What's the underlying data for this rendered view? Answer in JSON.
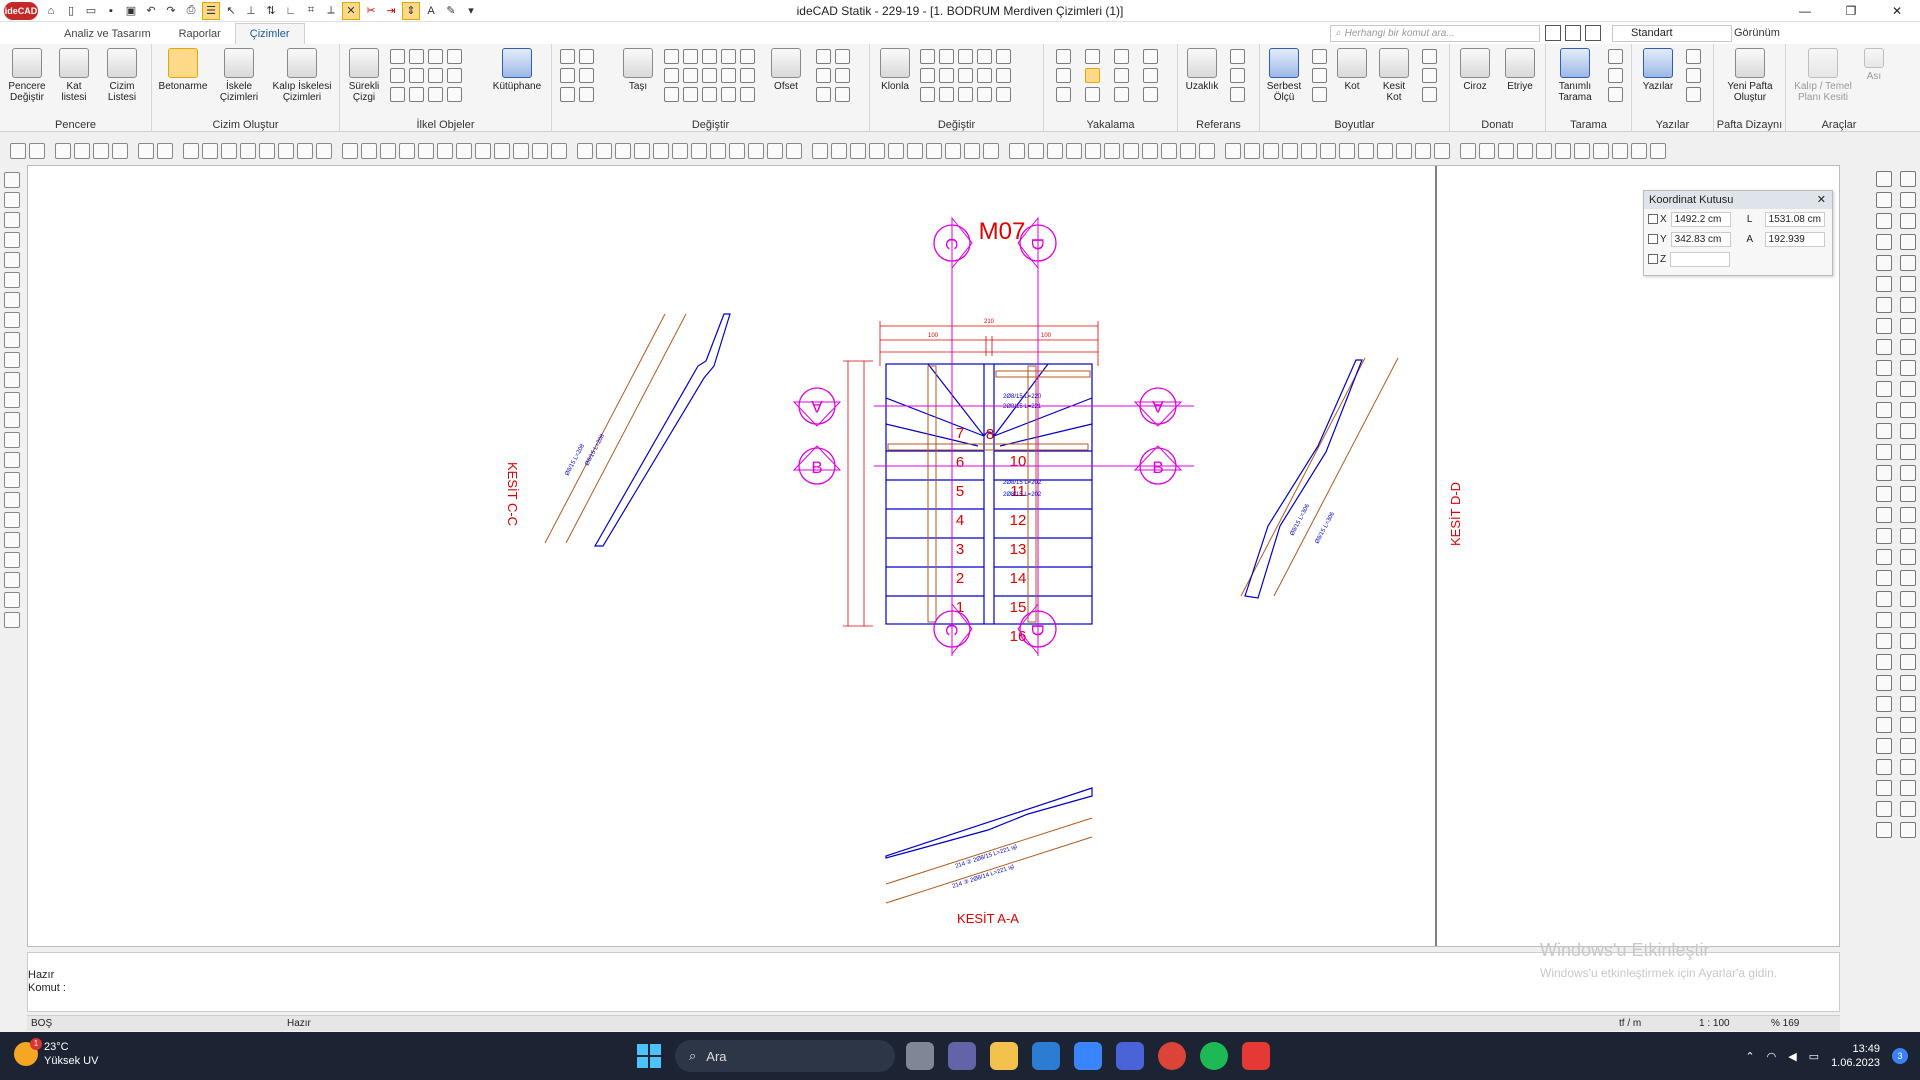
{
  "app": {
    "logo": "ideCAD",
    "title": "ideCAD Statik - 229-19 - [1. BODRUM Merdiven Çizimleri (1)]",
    "window_controls": [
      "—",
      "❐",
      "✕"
    ]
  },
  "ribbon_tabs": [
    {
      "label": "Analiz ve Tasarım",
      "active": false
    },
    {
      "label": "Raporlar",
      "active": false
    },
    {
      "label": "Çizimler",
      "active": true
    }
  ],
  "command_search": {
    "placeholder": "Herhangi bir komut ara..."
  },
  "style_select": {
    "value": "Standart"
  },
  "view_menu": {
    "label": "Görünüm"
  },
  "ribbon_groups": [
    {
      "title": "Pencere",
      "buttons": [
        "Pencere Değiştir",
        "Kat listesi",
        "Cizim Listesi"
      ]
    },
    {
      "title": "Cizim Oluştur",
      "buttons": [
        "Betonarme",
        "İskele Çizimleri",
        "Kalıp İskelesi Çizimleri"
      ]
    },
    {
      "title": "İlkel Objeler",
      "buttons": [
        "Sürekli Çizgi",
        "Kütüphane"
      ]
    },
    {
      "title": "Değiştir",
      "buttons": [
        "Taşı",
        "Ofset"
      ]
    },
    {
      "title": "Değiştir",
      "buttons": [
        "Klonla"
      ]
    },
    {
      "title": "Yakalama",
      "buttons": []
    },
    {
      "title": "Referans",
      "buttons": [
        "Uzaklık"
      ]
    },
    {
      "title": "Boyutlar",
      "buttons": [
        "Serbest Ölçü",
        "Kot",
        "Kesit Kot"
      ]
    },
    {
      "title": "Donatı",
      "buttons": [
        "Ciroz",
        "Etriye"
      ]
    },
    {
      "title": "Tarama",
      "buttons": [
        "Tanımlı Tarama"
      ]
    },
    {
      "title": "Yazılar",
      "buttons": [
        "Yazılar"
      ]
    },
    {
      "title": "Pafta Dizaynı",
      "buttons": [
        "Yeni Pafta Oluştur"
      ]
    },
    {
      "title": "Araçlar",
      "buttons": [
        "Kalıp / Temel Planı Kesiti",
        "Ası"
      ]
    }
  ],
  "coordinate_box": {
    "title": "Koordinat Kutusu",
    "x_label": "X",
    "x_value": "1492.2 cm",
    "y_label": "Y",
    "y_value": "342.83 cm",
    "z_label": "Z",
    "z_value": "",
    "l_label": "L",
    "l_value": "1531.08 cm",
    "a_label": "A",
    "a_value": "192.939"
  },
  "drawing": {
    "title": "M07",
    "section_aa": "KESİT  A-A",
    "section_cc": "KESİT  C-C",
    "section_dd": "KESİT  D-D",
    "markers": {
      "A": "A",
      "B": "B",
      "C": "C",
      "D": "D"
    },
    "steps_left": [
      "7",
      "6",
      "5",
      "4",
      "3",
      "2",
      "1"
    ],
    "steps_right": [
      "8",
      "10",
      "11",
      "12",
      "13",
      "14",
      "15",
      "16"
    ],
    "dims": {
      "top_total": "210",
      "top_left": "100",
      "top_right": "100"
    },
    "rebar_labels": [
      "2Ø8/15 L=220",
      "2Ø8/15 L=221",
      "2Ø8/15 L=202",
      "2Ø8/15 L=202",
      "214 ② 2Ø8/15 L=221 ışl",
      "214 ③ 2Ø8/14 L=221 ışl"
    ]
  },
  "command_area": {
    "line1": "Hazır",
    "line2": "Komut :"
  },
  "watermark": {
    "line1": "Windows'u Etkinleştir",
    "line2": "Windows'u etkinleştirmek için Ayarlar'a gidin."
  },
  "statusbar": {
    "left": "BOŞ",
    "mid": "Hazır",
    "units": "tf / m",
    "scale": "1 : 100",
    "zoom": "% 169"
  },
  "taskbar": {
    "weather_temp": "23°C",
    "weather_desc": "Yüksek UV",
    "weather_badge": "1",
    "search": "Ara",
    "time": "13:49",
    "date": "1.06.2023",
    "notifications": "3"
  },
  "colors": {
    "magenta": "#e000e0",
    "red": "#e00000",
    "blue": "#0000c8",
    "brown": "#b45a1e"
  }
}
